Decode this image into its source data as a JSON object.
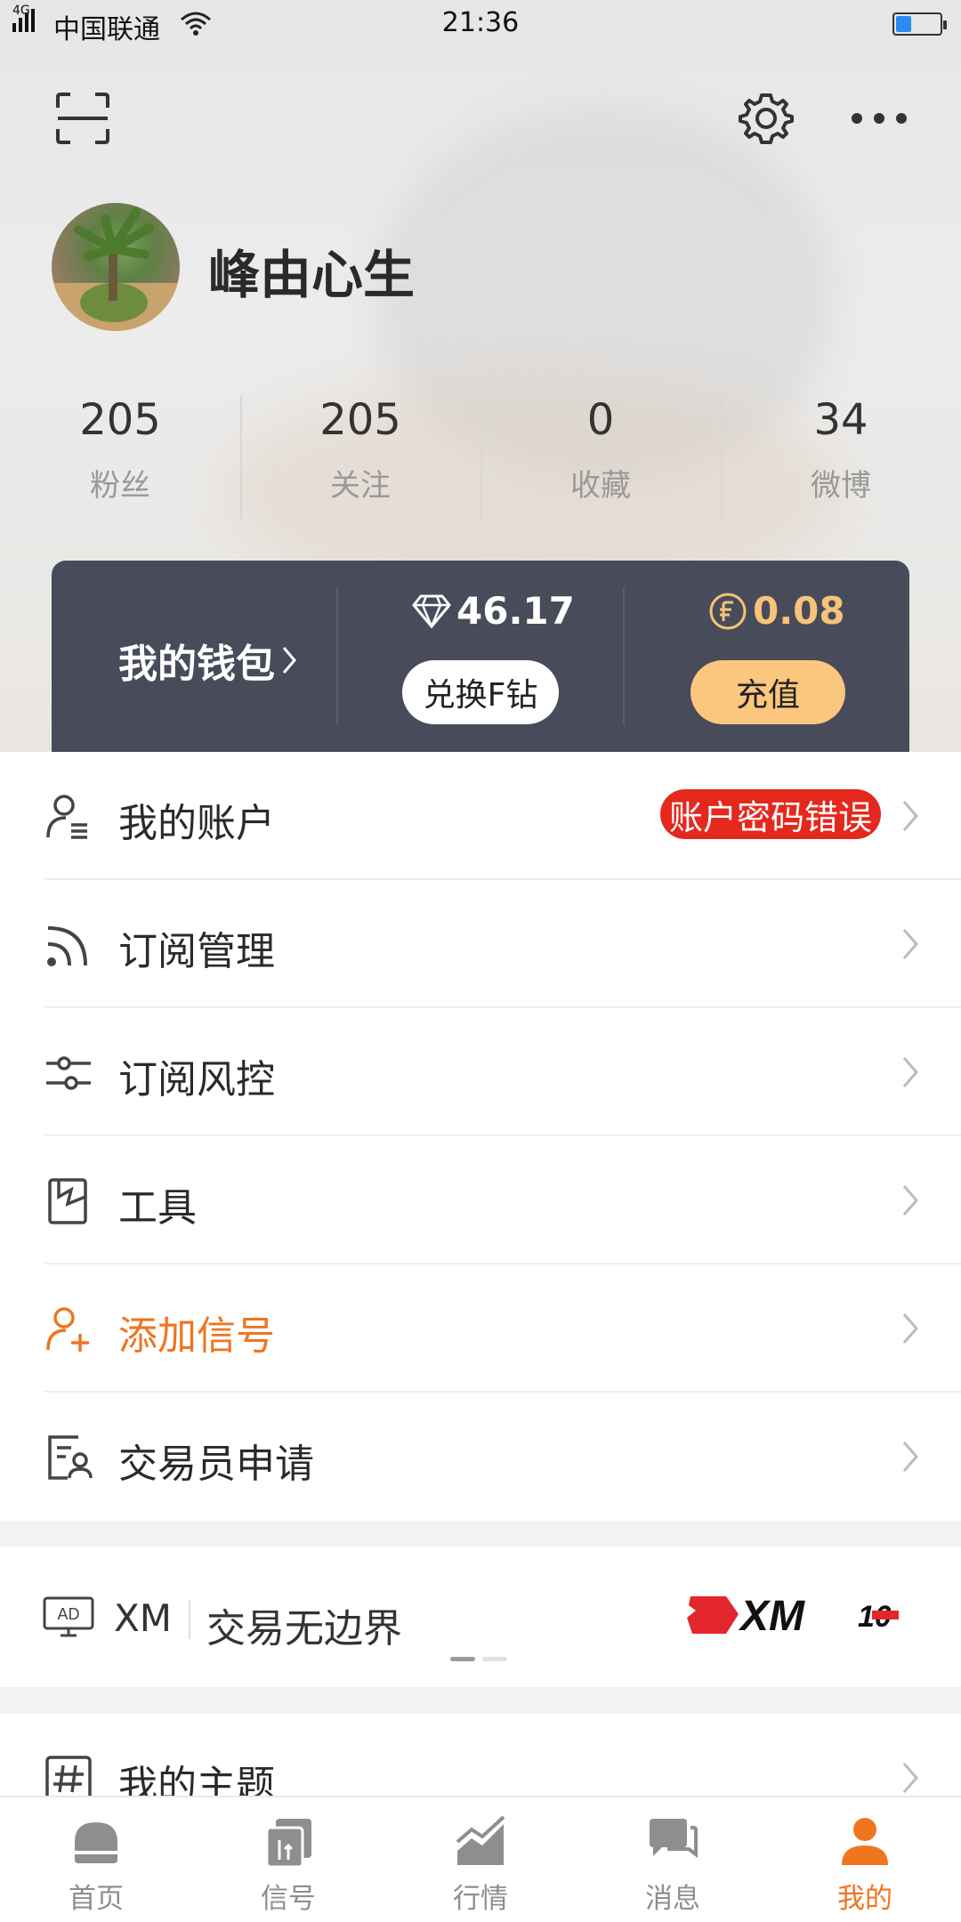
{
  "status_bar": {
    "network": "4G",
    "carrier": "中国联通",
    "time": "21:36",
    "battery_level": 0.35
  },
  "header": {
    "scan_icon": "scan-icon",
    "settings_icon": "gear-icon",
    "more_icon": "more-icon"
  },
  "profile": {
    "name": "峰由心生"
  },
  "stats": [
    {
      "value": "205",
      "label": "粉丝"
    },
    {
      "value": "205",
      "label": "关注"
    },
    {
      "value": "0",
      "label": "收藏"
    },
    {
      "value": "34",
      "label": "微博"
    }
  ],
  "wallet": {
    "title": "我的钱包",
    "diamond_value": "46.17",
    "exchange_button": "兑换F钻",
    "coin_value": "0.08",
    "recharge_button": "充值",
    "colors": {
      "panel": "#484c5a",
      "coin": "#f7c27a",
      "recharge_bg": "#fbc67e"
    }
  },
  "menu": [
    {
      "label": "我的账户",
      "icon": "user-list-icon",
      "badge": "账户密码错误"
    },
    {
      "label": "订阅管理",
      "icon": "rss-icon"
    },
    {
      "label": "订阅风控",
      "icon": "sliders-icon"
    },
    {
      "label": "工具",
      "icon": "tool-icon"
    },
    {
      "label": "添加信号",
      "icon": "add-user-icon",
      "highlight_color": "#f0751f"
    },
    {
      "label": "交易员申请",
      "icon": "trader-card-icon"
    }
  ],
  "ad": {
    "tag": "AD",
    "brand": "XM",
    "slogan": "交易无边界",
    "logo": "XM",
    "pages": 2,
    "current_page": 1
  },
  "topic": {
    "label": "我的主题",
    "icon": "hashtag-icon"
  },
  "tabs": [
    {
      "label": "首页",
      "icon": "home-icon"
    },
    {
      "label": "信号",
      "icon": "signal-icon"
    },
    {
      "label": "行情",
      "icon": "chart-icon"
    },
    {
      "label": "消息",
      "icon": "message-icon"
    },
    {
      "label": "我的",
      "icon": "me-icon",
      "active": true
    }
  ],
  "accent_color": "#f0751f"
}
